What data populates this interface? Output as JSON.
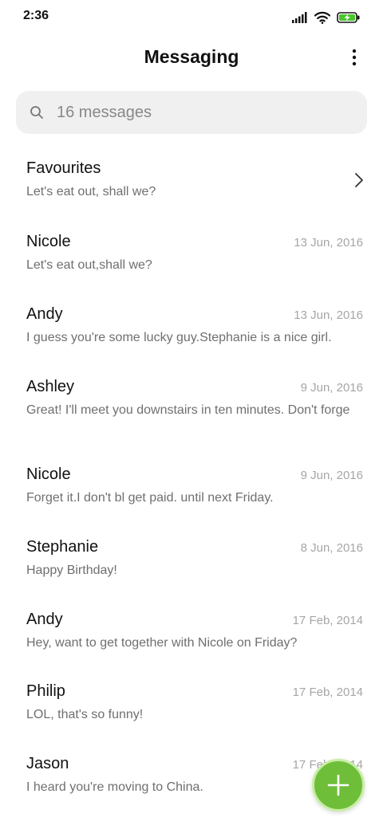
{
  "status_bar": {
    "time": "2:36",
    "battery_color": "#4cc42e"
  },
  "header": {
    "title": "Messaging",
    "menu_icon": "more-vertical-icon"
  },
  "search": {
    "placeholder": "16 messages",
    "icon": "search-icon"
  },
  "conversations": [
    {
      "name": "Favourites",
      "date": "",
      "preview": "Let's eat out, shall we?",
      "chevron": true
    },
    {
      "name": "Nicole",
      "date": "13 Jun, 2016",
      "preview": "Let's eat out,shall we?"
    },
    {
      "name": "Andy",
      "date": "13 Jun, 2016",
      "preview": "I guess you're some lucky guy.Stephanie is a nice girl."
    },
    {
      "name": "Ashley",
      "date": "9 Jun, 2016",
      "preview": "Great! I'll meet you downstairs in ten minutes. Don't forge"
    },
    {
      "name": "Nicole",
      "date": "9 Jun, 2016",
      "preview": "Forget it.I don't bl get paid. until next Friday."
    },
    {
      "name": "Stephanie",
      "date": "8 Jun, 2016",
      "preview": "Happy Birthday!"
    },
    {
      "name": "Andy",
      "date": "17 Feb, 2014",
      "preview": "Hey, want to get together with Nicole on Friday?"
    },
    {
      "name": "Philip",
      "date": "17 Feb, 2014",
      "preview": "LOL, that's so funny!"
    },
    {
      "name": "Jason",
      "date": "17 Feb, 2014",
      "preview": "I heard you're moving to China."
    }
  ],
  "fab": {
    "icon": "plus-icon",
    "color": "#6fbe3a"
  }
}
